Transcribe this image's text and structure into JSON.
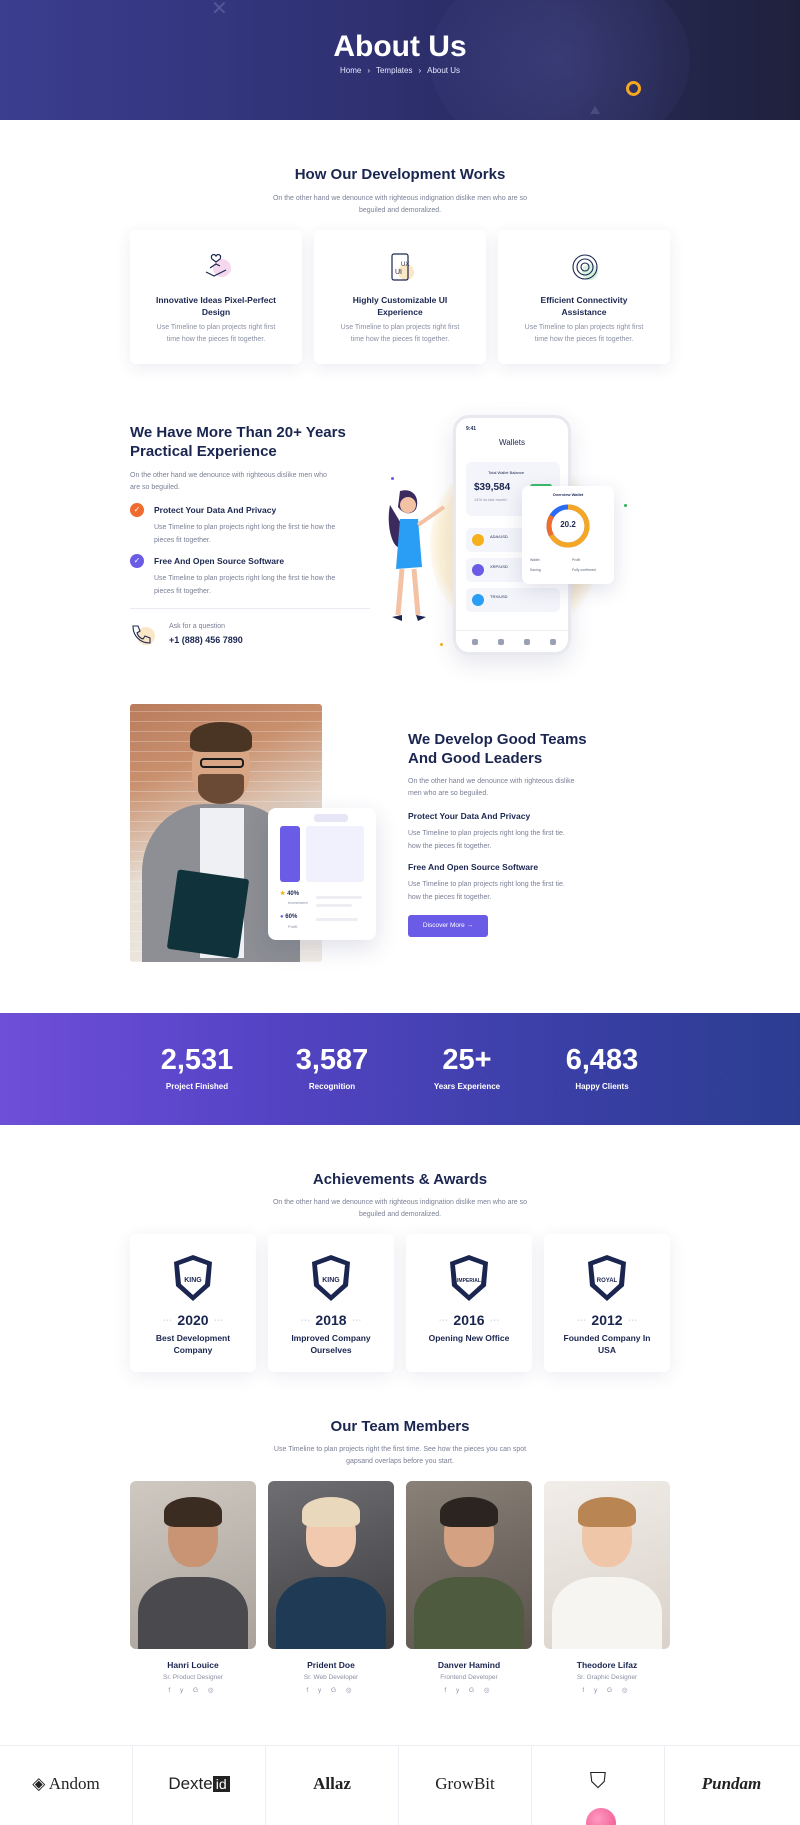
{
  "hero": {
    "title": "About Us",
    "breadcrumb": [
      "Home",
      "Templates",
      "About Us"
    ],
    "separator": "›"
  },
  "development": {
    "title": "How Our Development Works",
    "subtitle": "On the other hand we denounce with righteous indignation dislike men who are so beguiled and demoralized.",
    "cards": [
      {
        "icon": "hand-heart-icon",
        "title": "Innovative Ideas Pixel-Perfect Design",
        "desc": "Use Timeline to plan projects right first time how the pieces fit together."
      },
      {
        "icon": "ui-ux-icon",
        "title": "Highly Customizable UI Experience",
        "desc": "Use Timeline to plan projects right first time how the pieces fit together."
      },
      {
        "icon": "fingerprint-icon",
        "title": "Efficient Connectivity Assistance",
        "desc": "Use Timeline to plan projects right first time how the pieces fit together."
      }
    ]
  },
  "experience": {
    "title": "We Have More Than 20+ Years Practical Experience",
    "desc": "On the other hand we denounce with righteous dislike men who are so beguiled.",
    "items": [
      {
        "title": "Protect Your Data And Privacy",
        "desc": "Use Timeline to plan projects right long the first tie how the pieces fit together.",
        "color": "#f06b2e"
      },
      {
        "title": "Free And Open Source Software",
        "desc": "Use Timeline to plan projects right long the first tie how the pieces fit together.",
        "color": "#6b5ce7"
      }
    ],
    "ask": "Ask for a question",
    "phone": "+1 (888) 456 7890",
    "mockup": {
      "time": "9:41",
      "screen_title": "Wallets",
      "card_label": "Total Wallet Balance",
      "balance": "$39,584",
      "card_sub": "14% vs last month",
      "rows": [
        {
          "name": "ADA/USD",
          "value": "",
          "color": "#f5b01b"
        },
        {
          "name": "XRP/USD",
          "value": "",
          "color": "#6b5ce7"
        },
        {
          "name": "TRX/USD",
          "value": "",
          "color": "#2a9df4"
        }
      ],
      "donut_title": "Overview Wallet",
      "donut_value": "20.2",
      "donut_legend": [
        "Wallet",
        "Profit",
        "Saving",
        "Fully confirmed"
      ]
    }
  },
  "teams": {
    "title": "We Develop Good Teams And Good Leaders",
    "desc": "On the other hand we denounce with righteous dislike men who are so beguiled.",
    "items": [
      {
        "title": "Protect Your Data And Privacy",
        "desc": "Use Timeline to plan projects right long the first tie. how the pieces fit together."
      },
      {
        "title": "Free And Open Source Software",
        "desc": "Use Timeline to plan projects right long the first tie. how the pieces fit together."
      }
    ],
    "button": "Discover More",
    "dash": {
      "stat1": "40%",
      "stat1_label": "Investment",
      "stat2": "60%",
      "stat2_label": "Profit"
    }
  },
  "stats": [
    {
      "value": "2,531",
      "label": "Project Finished"
    },
    {
      "value": "3,587",
      "label": "Recognition"
    },
    {
      "value": "25+",
      "label": "Years Experience"
    },
    {
      "value": "6,483",
      "label": "Happy Clients"
    }
  ],
  "awards": {
    "title": "Achievements & Awards",
    "subtitle": "On the other hand we denounce with righteous indignation dislike men who are so beguiled and demoralized.",
    "items": [
      {
        "year": "2020",
        "label": "Best Development Company",
        "badge_text": "KING"
      },
      {
        "year": "2018",
        "label": "Improved Company Ourselves",
        "badge_text": "KING"
      },
      {
        "year": "2016",
        "label": "Opening New Office",
        "badge_text": "IMPERIAL"
      },
      {
        "year": "2012",
        "label": "Founded Company In USA",
        "badge_text": "ROYAL"
      }
    ]
  },
  "team_members": {
    "title": "Our Team Members",
    "subtitle": "Use Timeline to plan projects right the first time. See how the pieces you can spot gapsand overlaps before you start.",
    "members": [
      {
        "name": "Hanri Louice",
        "role": "Sr. Product Designer",
        "social": "f y G ◎"
      },
      {
        "name": "Prident Doe",
        "role": "Sr. Web Developer",
        "social": "f y G ◎"
      },
      {
        "name": "Danver Hamind",
        "role": "Frontend Developer",
        "social": "f y G ◎"
      },
      {
        "name": "Theodore Lifaz",
        "role": "Sr. Graphic Designer",
        "social": "f y G ◎"
      }
    ]
  },
  "brands": [
    "Andom",
    "Dexte",
    "id",
    "Allaz",
    "GrowBit",
    "",
    "Pundam"
  ],
  "colors": {
    "accent": "#6b5ce7",
    "navy": "#1b2650",
    "orange": "#f06b2e",
    "hero_dark": "#1f213c"
  }
}
